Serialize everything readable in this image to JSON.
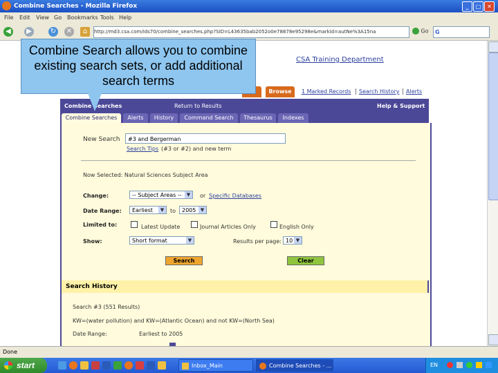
{
  "window": {
    "title": "Combine Searches - Mozilla Firefox",
    "min": "_",
    "max": "□",
    "close": "✕"
  },
  "menu": [
    "File",
    "Edit",
    "View",
    "Go",
    "Bookmarks",
    "Tools",
    "Help"
  ],
  "nav": {
    "url": "http://md3.csa.com/ids70/combine_searches.php?SID=L43635bab2052o0e78878e95298e&markid=autNe%3A15na",
    "go": "Go",
    "search_value": "G"
  },
  "page": {
    "dept_link": "CSA Training Department",
    "top_tab_partial": "s",
    "browse_tab": "Browse",
    "top_links": [
      "1 Marked Records",
      "Search History",
      "Alerts"
    ],
    "bar_left": "Combine Searches",
    "bar_mid": "Return to Results",
    "bar_right": "Help & Support",
    "subtabs": [
      "Combine Searches",
      "Alerts",
      "History",
      "Command Search",
      "Thesaurus",
      "Indexes"
    ],
    "new_search_label": "New Search",
    "new_search_value": "#3 and Bergerman",
    "search_tips": "Search Tips",
    "search_tips_suffix": "(#3 or #2) and new term",
    "now_selected": "Now Selected: Natural Sciences Subject Area",
    "change_label": "Change:",
    "change_value": "-- Subject Areas --",
    "or_text": "or",
    "specific_db": "Specific Databases",
    "date_label": "Date Range:",
    "date_from": "Earliest",
    "to_text": "to",
    "date_to": "2005",
    "limited_label": "Limited to:",
    "limit_options": [
      "Latest Update",
      "Journal Articles Only",
      "English Only"
    ],
    "show_label": "Show:",
    "show_value": "Short format",
    "results_label": "Results per page:",
    "results_value": "10",
    "search_btn": "Search",
    "clear_btn": "Clear"
  },
  "history": {
    "heading": "Search History",
    "entry_title": "Search #3 (551 Results)",
    "entry_query": "KW=(water pollution) and KW=(Atlantic Ocean) and not KW=(North Sea)",
    "date_label": "Date Range:",
    "date_value": "Earliest to 2005"
  },
  "callout": {
    "text": "Combine Search allows you to combine existing search sets, or add additional search terms"
  },
  "status": "Done",
  "taskbar": {
    "start": "start",
    "tasks": [
      "Inbox_Main",
      "Combine Searches - ..."
    ],
    "tray_text": "EN"
  },
  "colors": {
    "purple": "#4c4898",
    "orange": "#d76a1d",
    "panel": "#fffbdc",
    "callout": "#8ec6f0"
  }
}
